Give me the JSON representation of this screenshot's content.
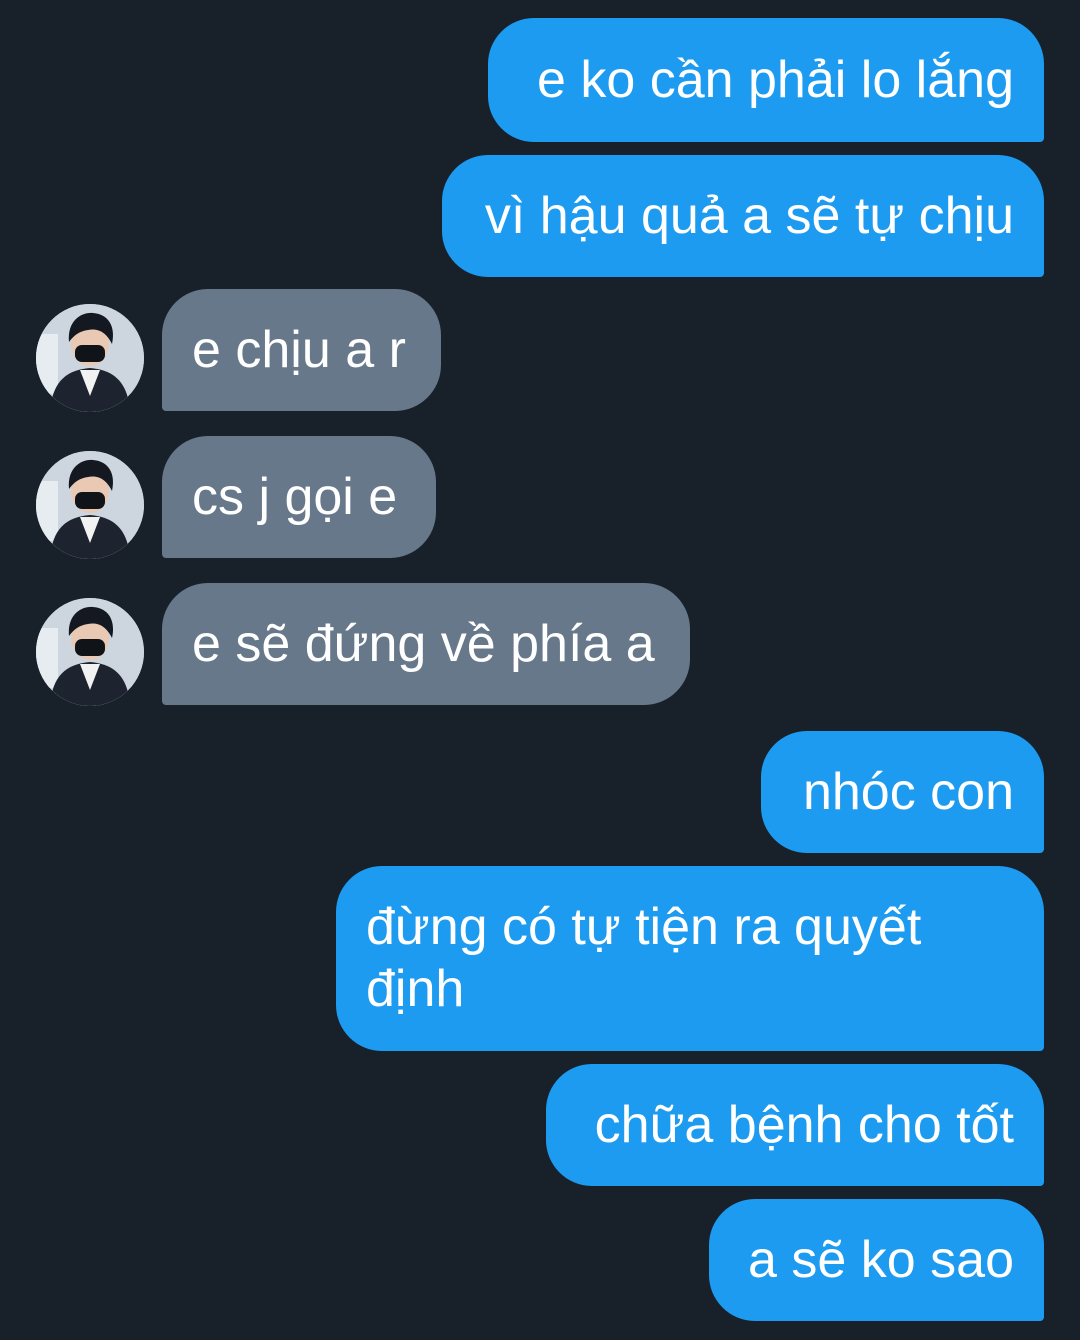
{
  "conversation": {
    "messages": [
      {
        "direction": "sent",
        "text": "e ko cần phải lo lắng"
      },
      {
        "direction": "sent",
        "text": "vì hậu quả a sẽ tự chịu"
      },
      {
        "direction": "received",
        "text": "e chịu a r",
        "avatar_icon": "user-avatar-icon"
      },
      {
        "direction": "received",
        "text": "cs j gọi e",
        "avatar_icon": "user-avatar-icon"
      },
      {
        "direction": "received",
        "text": "e sẽ đứng về phía a",
        "avatar_icon": "user-avatar-icon"
      },
      {
        "direction": "sent",
        "text": "nhóc con"
      },
      {
        "direction": "sent",
        "text": "đừng có tự tiện ra quyết định"
      },
      {
        "direction": "sent",
        "text": "chữa bệnh cho tốt"
      },
      {
        "direction": "sent",
        "text": "a sẽ ko sao"
      }
    ]
  },
  "colors": {
    "background": "#18202a",
    "sent_bubble": "#1d9bf0",
    "received_bubble": "#67788a",
    "text": "#ffffff"
  }
}
